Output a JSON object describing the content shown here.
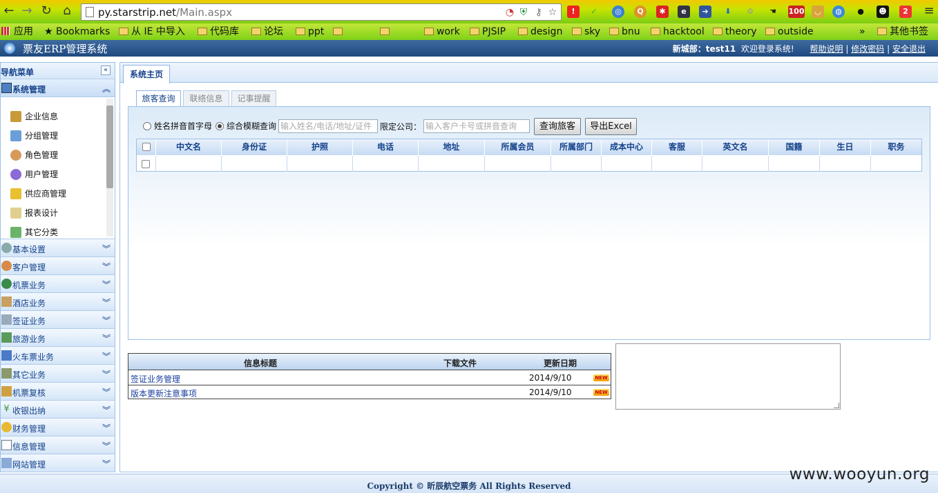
{
  "browser": {
    "url_host": "py.starstrip.net",
    "url_path": "/Main.aspx",
    "bookmarks": [
      "应用",
      "Bookmarks",
      "从 IE 中导入",
      "代码库",
      "论坛",
      "ppt",
      "",
      "",
      "work",
      "PJSIP",
      "design",
      "sky",
      "bnu",
      "hacktool",
      "theory",
      "outside",
      "»",
      "其他书签"
    ],
    "badge_mail": "100",
    "badge_ext": "2"
  },
  "header": {
    "title": "票友ERP管理系统",
    "user_label": "新城部：test11",
    "welcome": "欢迎登录系统!",
    "links": [
      "帮助说明",
      "修改密码",
      "安全退出"
    ],
    "separator": "|"
  },
  "sidebar": {
    "title": "导航菜单",
    "collapse": "«",
    "open_section": "系统管理",
    "open_items": [
      "企业信息",
      "分组管理",
      "角色管理",
      "用户管理",
      "供应商管理",
      "报表设计",
      "其它分类"
    ],
    "sections": [
      "基本设置",
      "客户管理",
      "机票业务",
      "酒店业务",
      "签证业务",
      "旅游业务",
      "火车票业务",
      "其它业务",
      "机票复核",
      "收银出纳",
      "财务管理",
      "信息管理",
      "网站管理"
    ]
  },
  "main": {
    "tab": "系统主页",
    "subtabs": [
      "旅客查询",
      "联络信息",
      "记事提醒"
    ],
    "radio_pinyin": "姓名拼音首字母",
    "radio_fuzzy": "综合模糊查询",
    "fuzzy_placeholder": "输入姓名/电话/地址/证件",
    "company_label": "限定公司：",
    "company_placeholder": "输入客户卡号或拼音查询",
    "btn_search": "查询旅客",
    "btn_export": "导出Excel",
    "columns": [
      "中文名",
      "身份证",
      "护照",
      "电话",
      "地址",
      "所属会员",
      "所属部门",
      "成本中心",
      "客服",
      "英文名",
      "国籍",
      "生日",
      "职务"
    ]
  },
  "info": {
    "col_title": "信息标题",
    "col_download": "下载文件",
    "col_date": "更新日期",
    "rows": [
      {
        "title": "签证业务管理",
        "date": "2014/9/10",
        "badge": "NEW"
      },
      {
        "title": "版本更新注意事项",
        "date": "2014/9/10",
        "badge": "NEW"
      }
    ]
  },
  "footer": {
    "copyright": "Copyright © 昕辰航空票务 All Rights Reserved"
  },
  "watermark": "www.wooyun.org"
}
